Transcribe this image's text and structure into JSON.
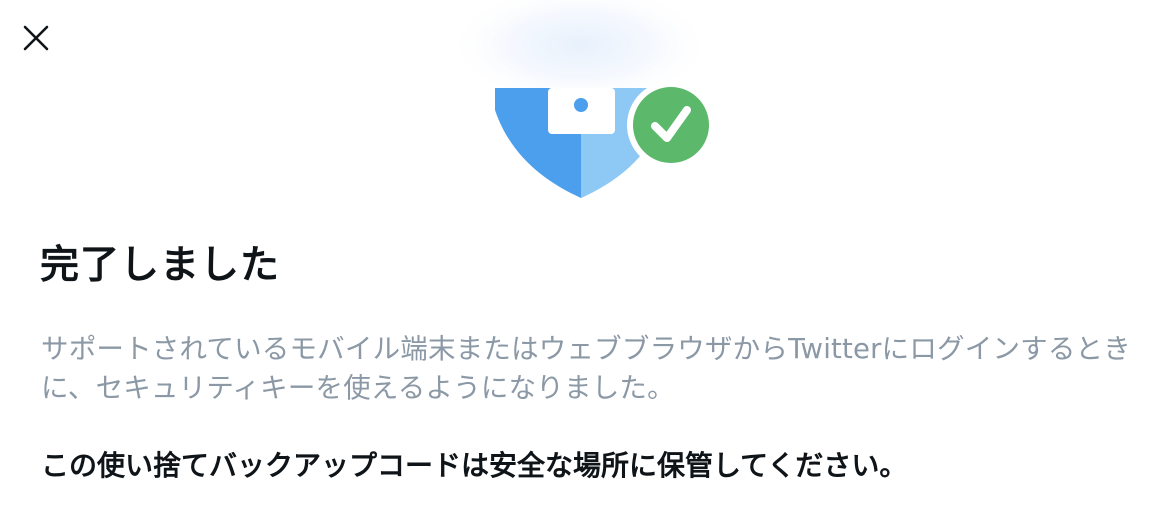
{
  "dialog": {
    "close_icon": "close-icon",
    "hero_icon": "security-key-shield-check-icon",
    "title": "完了しました",
    "description": "サポートされているモバイル端末またはウェブブラウザからTwitterにログインするときに、セキュリティキーを使えるようになりました。",
    "instruction": "この使い捨てバックアップコードは安全な場所に保管してください。"
  },
  "colors": {
    "shield_left": "#4b9fed",
    "shield_right": "#8ec8f4",
    "check_badge": "#5cb96b",
    "title_text": "#0f1419",
    "description_text": "#8b98a5"
  }
}
